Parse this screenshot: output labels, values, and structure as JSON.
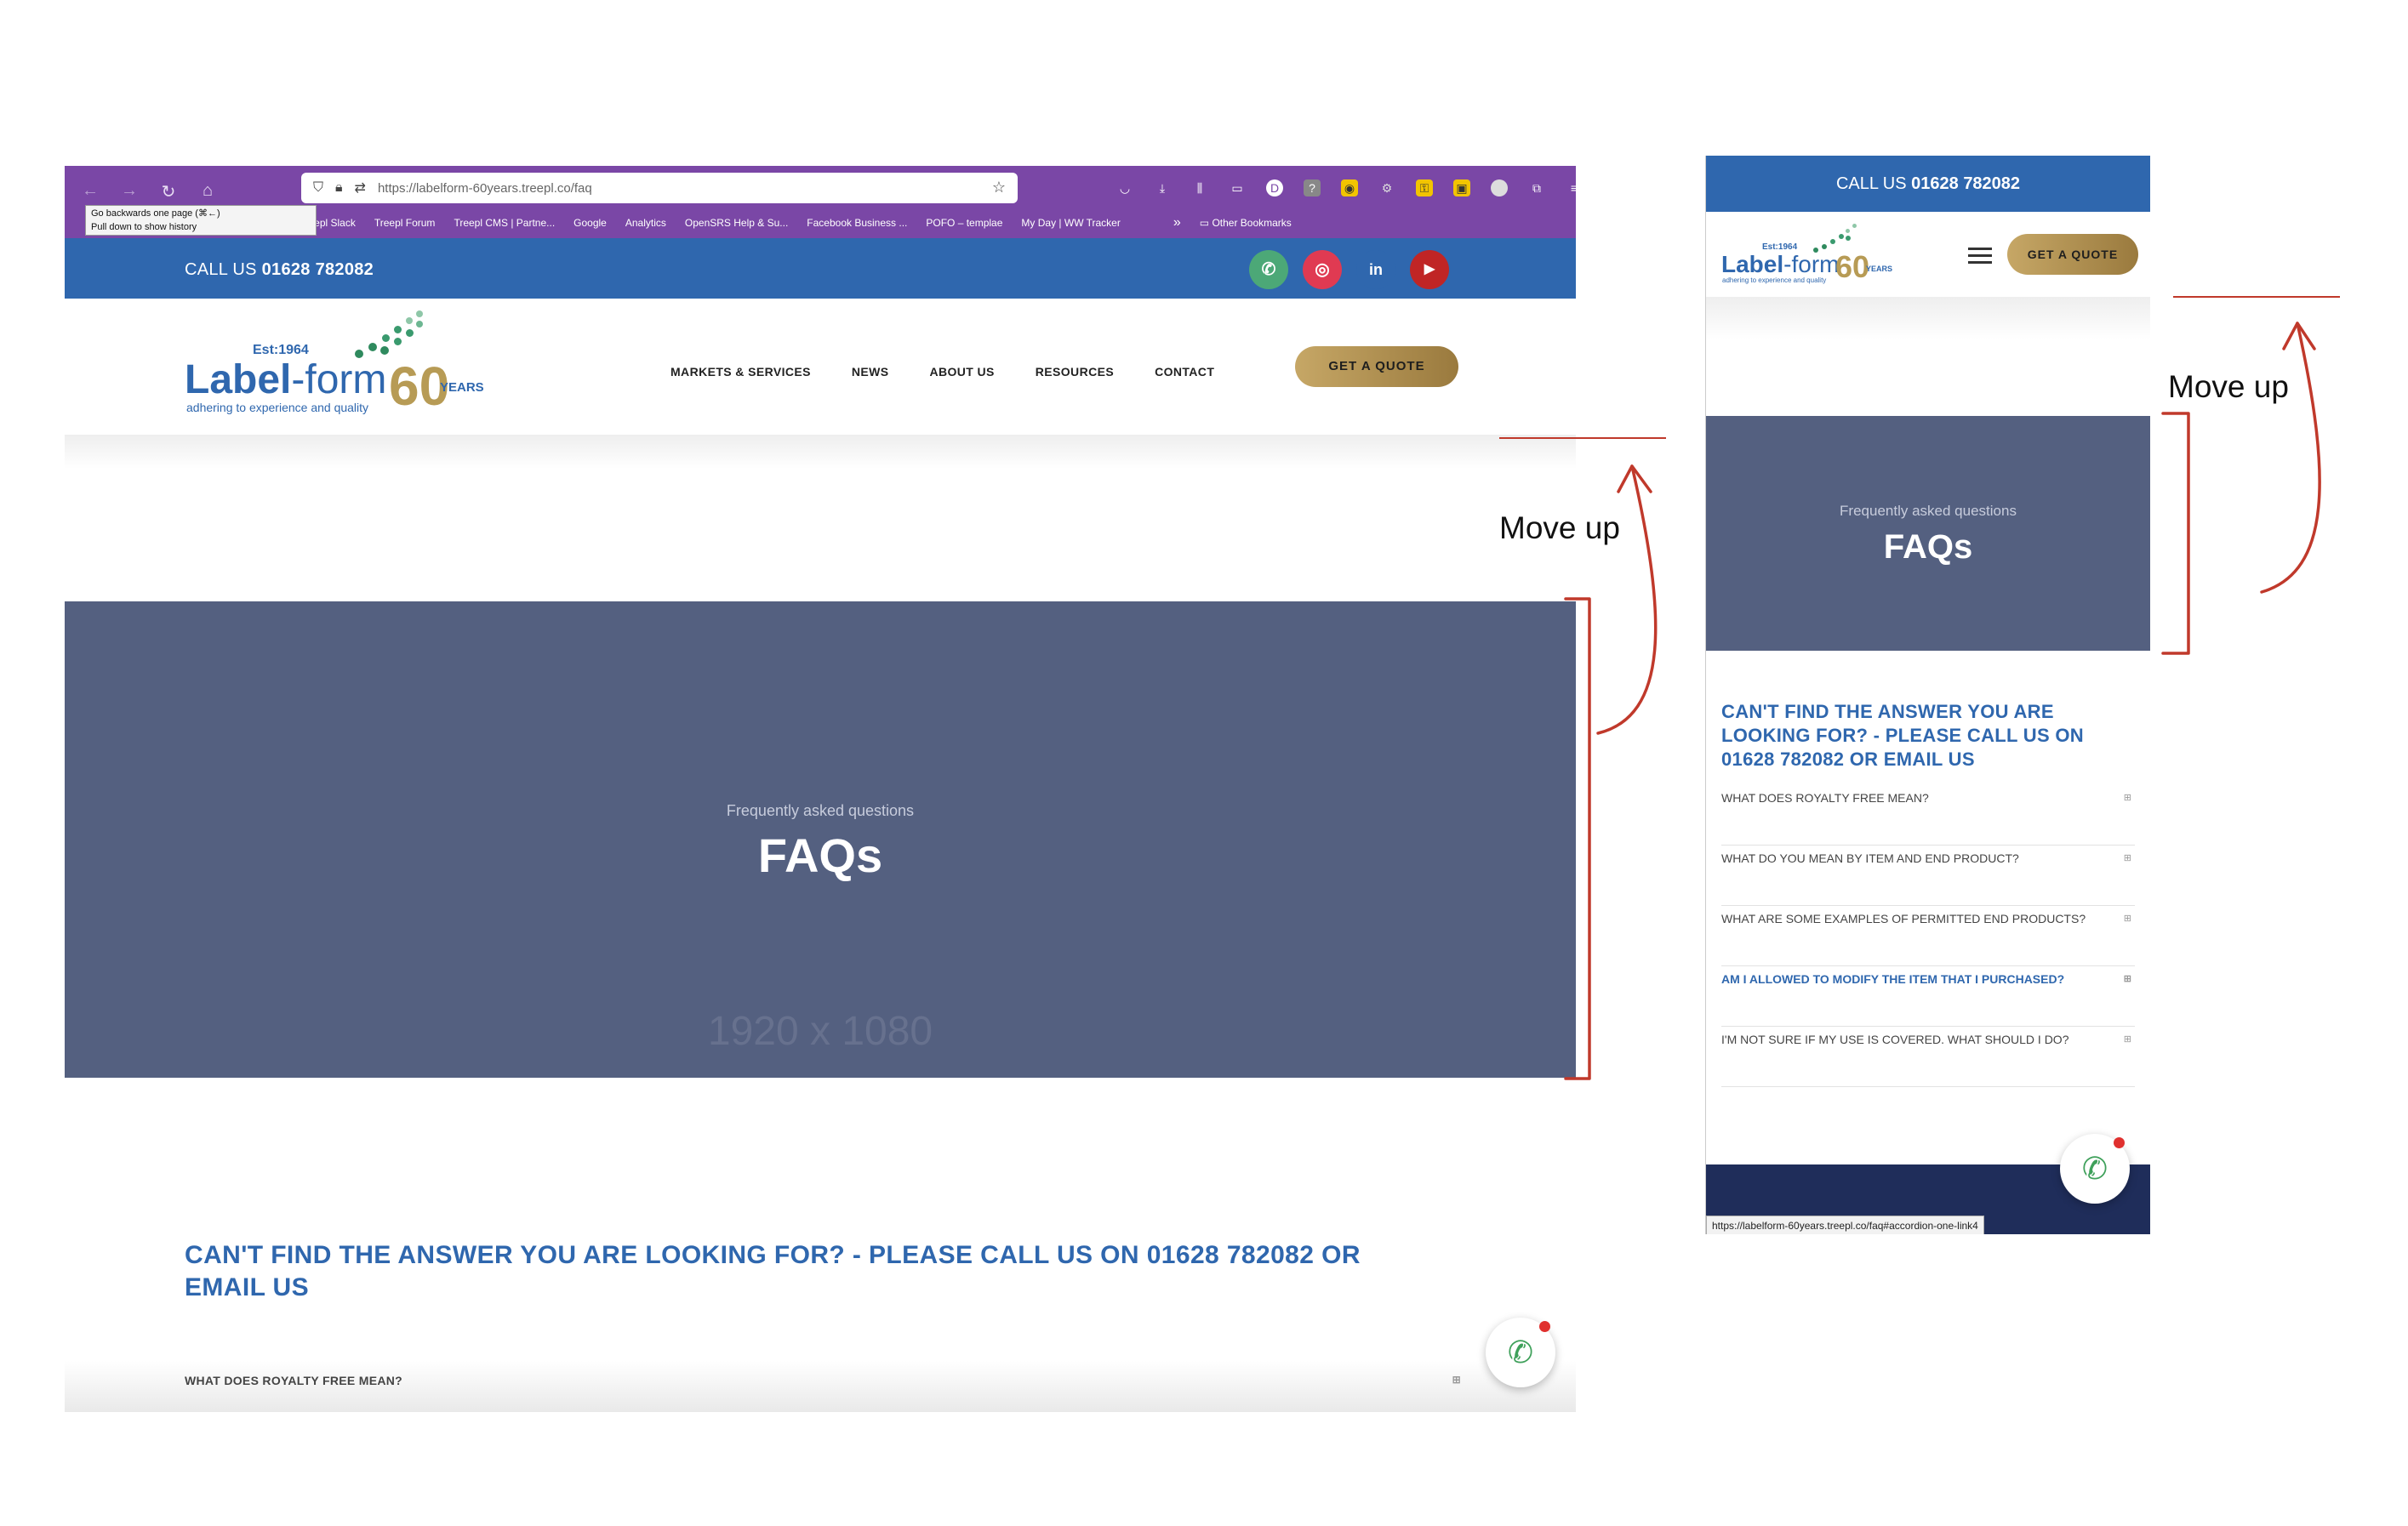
{
  "desktop": {
    "browser": {
      "url": "https://labelform-60years.treepl.co/faq",
      "tooltip_line1": "Go backwards one page (⌘←)",
      "tooltip_line2": "Pull down to show history",
      "bookmarks": [
        "general | Treepl Slack",
        "Treepl Forum",
        "Treepl CMS | Partne...",
        "Google",
        "Analytics",
        "OpenSRS Help & Su...",
        "Facebook Business ...",
        "POFO – templae",
        "My Day | WW Tracker"
      ],
      "bookmarks_overflow": "»",
      "other_bookmarks": "Other Bookmarks"
    },
    "callbar": {
      "prefix": "CALL US",
      "number": "01628 782082"
    },
    "logo": {
      "est": "Est:1964",
      "name_part1": "Label",
      "name_part2": "-form",
      "tagline": "adhering to experience and quality",
      "sixty": "60",
      "years": "YEARS"
    },
    "menu": [
      "MARKETS & SERVICES",
      "NEWS",
      "ABOUT US",
      "RESOURCES",
      "CONTACT"
    ],
    "quote_button": "GET A QUOTE",
    "hero": {
      "subtitle": "Frequently asked questions",
      "title": "FAQs",
      "placeholder": "1920 x 1080"
    },
    "faq_heading": "CAN'T FIND THE ANSWER YOU ARE LOOKING FOR? - PLEASE CALL US ON 01628 782082 OR EMAIL US",
    "faq_first": "WHAT DOES ROYALTY FREE MEAN?"
  },
  "mobile": {
    "callbar": {
      "prefix": "CALL US",
      "number": "01628 782082"
    },
    "logo": {
      "est": "Est:1964",
      "name_part1": "Label",
      "name_part2": "-form",
      "tagline": "adhering to experience and quality",
      "sixty": "60",
      "years": "YEARS"
    },
    "quote_button": "GET A QUOTE",
    "hero": {
      "subtitle": "Frequently asked questions",
      "title": "FAQs"
    },
    "faq_heading": "CAN'T FIND THE ANSWER YOU ARE LOOKING FOR? - PLEASE CALL US ON 01628 782082 OR EMAIL US",
    "faq_items": [
      "WHAT DOES ROYALTY FREE MEAN?",
      "WHAT DO YOU MEAN BY ITEM AND END PRODUCT?",
      "WHAT ARE SOME EXAMPLES OF PERMITTED END PRODUCTS?",
      "AM I ALLOWED TO MODIFY THE ITEM THAT I PURCHASED?",
      "I'M NOT SURE IF MY USE IS COVERED. WHAT SHOULD I DO?"
    ],
    "status_url": "https://labelform-60years.treepl.co/faq#accordion-one-link4"
  },
  "annotations": {
    "desktop_note": "Move up",
    "mobile_note": "Move up"
  },
  "colors": {
    "brand_blue": "#2f67ae",
    "hero_bg": "#546080",
    "gold": "#b79b55",
    "browser_purple": "#7a47a6",
    "annotation_red": "#c0392b"
  }
}
